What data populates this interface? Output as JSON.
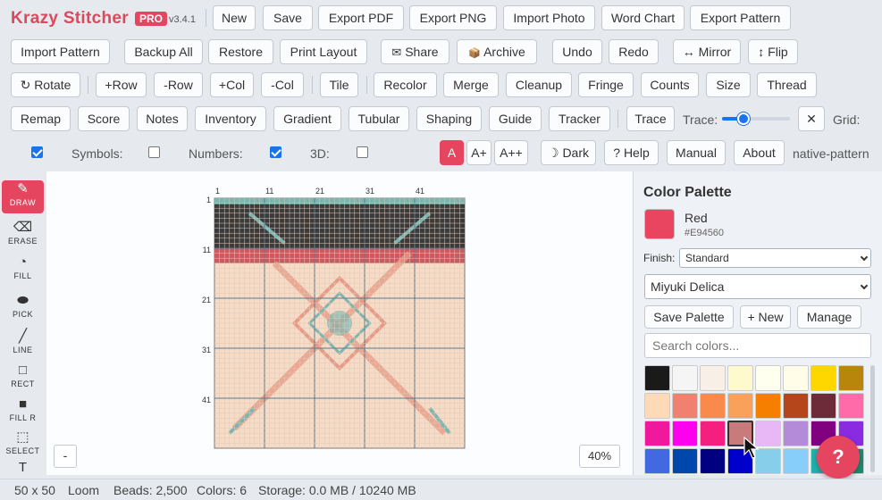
{
  "app": {
    "brand": "Krazy Stitcher",
    "badge": "PRO",
    "version": "v3.4.1"
  },
  "row1": [
    "New",
    "Save",
    "Export PDF",
    "Export PNG",
    "Import Photo",
    "Word Chart",
    "Export Pattern"
  ],
  "row2": [
    "Import Pattern",
    "Backup All",
    "Restore",
    "Print Layout",
    "Share",
    "Archive",
    "Undo",
    "Redo",
    "Mirror",
    "Flip"
  ],
  "row2_icons": {
    "share": "✉",
    "archive": "📦",
    "mirror": "↔",
    "flip": "↕"
  },
  "row3": [
    "Rotate",
    "+Row",
    "-Row",
    "+Col",
    "-Col",
    "Tile",
    "Recolor",
    "Merge",
    "Cleanup",
    "Fringe",
    "Counts",
    "Size",
    "Thread"
  ],
  "row3_icons": {
    "rotate": "↻"
  },
  "row4": [
    "Remap",
    "Score",
    "Notes",
    "Inventory",
    "Gradient",
    "Tubular",
    "Shaping",
    "Guide",
    "Tracker",
    "Trace"
  ],
  "trace": {
    "label": "Trace:",
    "value": 0.32,
    "close": "✕",
    "grid_label": "Grid:"
  },
  "row5": {
    "symbols": "Symbols:",
    "numbers": "Numbers:",
    "threed": "3D:",
    "font_a": "A",
    "font_ap": "A+",
    "font_app": "A++",
    "dark": "Dark",
    "dark_icon": "☽",
    "help": "? Help",
    "manual": "Manual",
    "about": "About",
    "native": "native-pattern"
  },
  "tools": [
    {
      "label": "DRAW",
      "icon": "✎"
    },
    {
      "label": "ERASE",
      "icon": "⌫"
    },
    {
      "label": "FILL",
      "icon": "◔"
    },
    {
      "label": "PICK",
      "icon": "⬬"
    },
    {
      "label": "LINE",
      "icon": "╱"
    },
    {
      "label": "RECT",
      "icon": "□"
    },
    {
      "label": "FILL R",
      "icon": "■"
    },
    {
      "label": "SELECT",
      "icon": "⬚"
    },
    {
      "label": "",
      "icon": "T"
    }
  ],
  "canvas": {
    "zoom": "40%",
    "minus": "-",
    "col_labels": [
      "1",
      "11",
      "21",
      "31",
      "41"
    ],
    "row_labels": [
      "1",
      "11",
      "21",
      "31",
      "41"
    ],
    "grid_cols": 50,
    "grid_rows": 50
  },
  "palette": {
    "title": "Color Palette",
    "current_name": "Red",
    "current_hex": "#E94560",
    "finish_label": "Finish:",
    "finish_value": "Standard",
    "brand_value": "Miyuki Delica",
    "save": "Save Palette",
    "new": "+ New",
    "manage": "Manage",
    "search_placeholder": "Search colors...",
    "swatches": [
      "#1a1a1a",
      "#f5f5f5",
      "#f8f0e6",
      "#fffacd",
      "#fffff0",
      "#fffde7",
      "#ffd700",
      "#b8860b",
      "#ffdab9",
      "#f08070",
      "#f98a4b",
      "#f9a05a",
      "#f77f00",
      "#b5451b",
      "#6d2b3a",
      "#ff6aa8",
      "#f0189c",
      "#ff00ee",
      "#f51f7f",
      "#c97a7a",
      "#e7b8f5",
      "#b38bd8",
      "#800080",
      "#8a2be2",
      "#4169e1",
      "#0047ab",
      "#000080",
      "#0000cd",
      "#87ceeb",
      "#87cefa",
      "#20b2aa",
      "#1f8a6f"
    ],
    "selected_index": 19
  },
  "help_fab": "?",
  "status": {
    "size": "50 x 50",
    "mode": "Loom",
    "beads": "Beads: 2,500",
    "colors": "Colors: 6",
    "storage": "Storage: 0.0 MB / 10240 MB"
  },
  "colors": {
    "accent": "#E64560",
    "pattern_peach": "#f6dcc6",
    "pattern_dark": "#3b3b3b",
    "pattern_red": "#c95b60",
    "pattern_teal": "#7db5b0",
    "pattern_salmon": "#e89a86"
  }
}
